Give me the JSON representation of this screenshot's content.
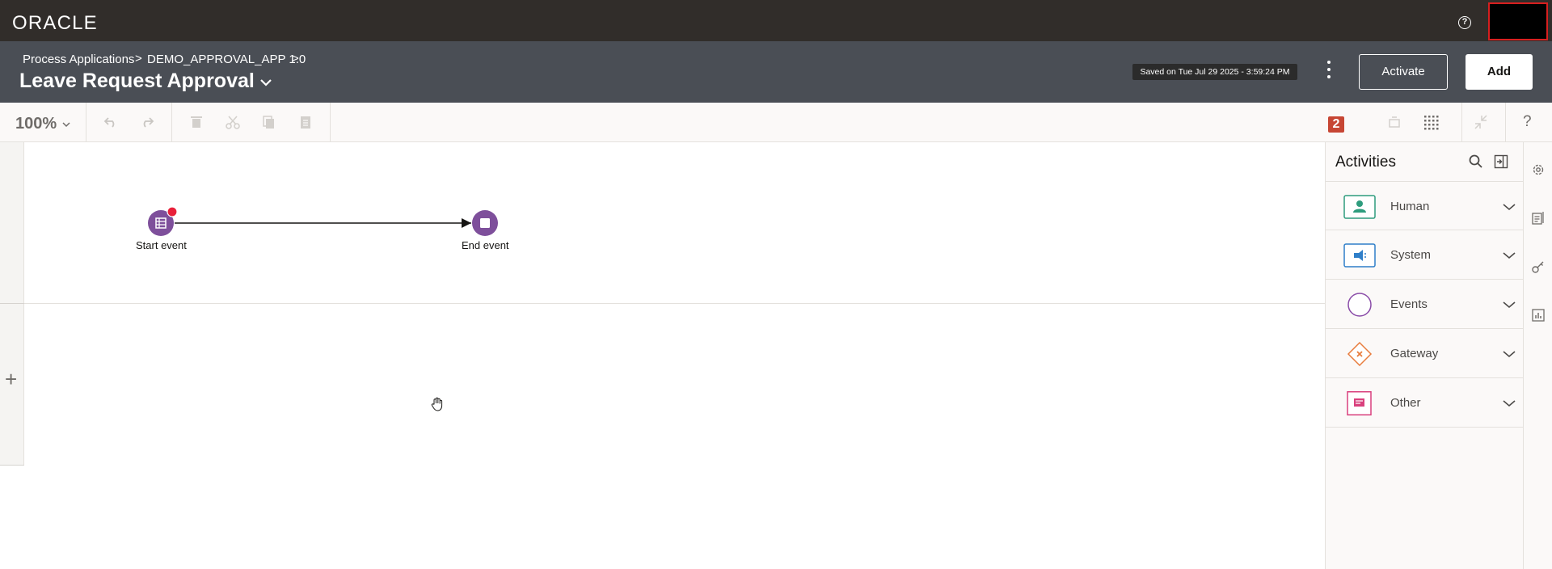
{
  "topbar": {
    "logo": "ORACLE",
    "help_glyph": "?"
  },
  "header": {
    "breadcrumbs": [
      "Process Applications",
      "DEMO_APPROVAL_APP 1.0"
    ],
    "crumb_separator": ">",
    "title": "Leave Request Approval",
    "saved_status": "Saved on Tue Jul 29 2025 - 3:59:24 PM",
    "activate_label": "Activate",
    "add_label": "Add"
  },
  "toolbar": {
    "zoom": "100%",
    "errors_count": "2",
    "help_glyph": "?"
  },
  "canvas": {
    "add_lane_glyph": "+",
    "start_event_label": "Start event",
    "end_event_label": "End event"
  },
  "activities": {
    "title": "Activities",
    "categories": [
      {
        "label": "Human",
        "icon": "person-icon",
        "color": "#2e9c7d"
      },
      {
        "label": "System",
        "icon": "service-icon",
        "color": "#2f7fc9"
      },
      {
        "label": "Events",
        "icon": "circle-event-icon",
        "color": "#8a4ca8"
      },
      {
        "label": "Gateway",
        "icon": "gateway-diamond-icon",
        "color": "#e87d3e"
      },
      {
        "label": "Other",
        "icon": "note-icon",
        "color": "#d9407d"
      }
    ]
  },
  "colors": {
    "topbar": "#312d2a",
    "header": "#4a4e55",
    "event_purple": "#7e4f9b",
    "error_red": "#c74634"
  }
}
